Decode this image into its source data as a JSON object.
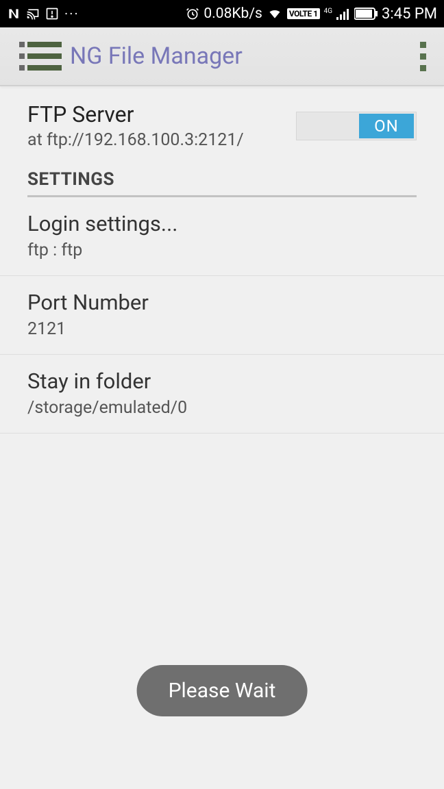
{
  "status_bar": {
    "speed": "0.08Kb/s",
    "volte": "VOLTE 1",
    "network_gen": "4G",
    "time": "3:45 PM"
  },
  "app_bar": {
    "title": "NG File Manager"
  },
  "ftp": {
    "title": "FTP Server",
    "address_prefix": "at ",
    "address": "ftp://192.168.100.3:2121/",
    "toggle_state": "ON"
  },
  "section": {
    "header": "SETTINGS"
  },
  "items": [
    {
      "title": "Login settings...",
      "sub": "ftp : ftp"
    },
    {
      "title": "Port Number",
      "sub": "2121"
    },
    {
      "title": "Stay in folder",
      "sub": "/storage/emulated/0"
    }
  ],
  "toast": {
    "text": "Please Wait"
  }
}
